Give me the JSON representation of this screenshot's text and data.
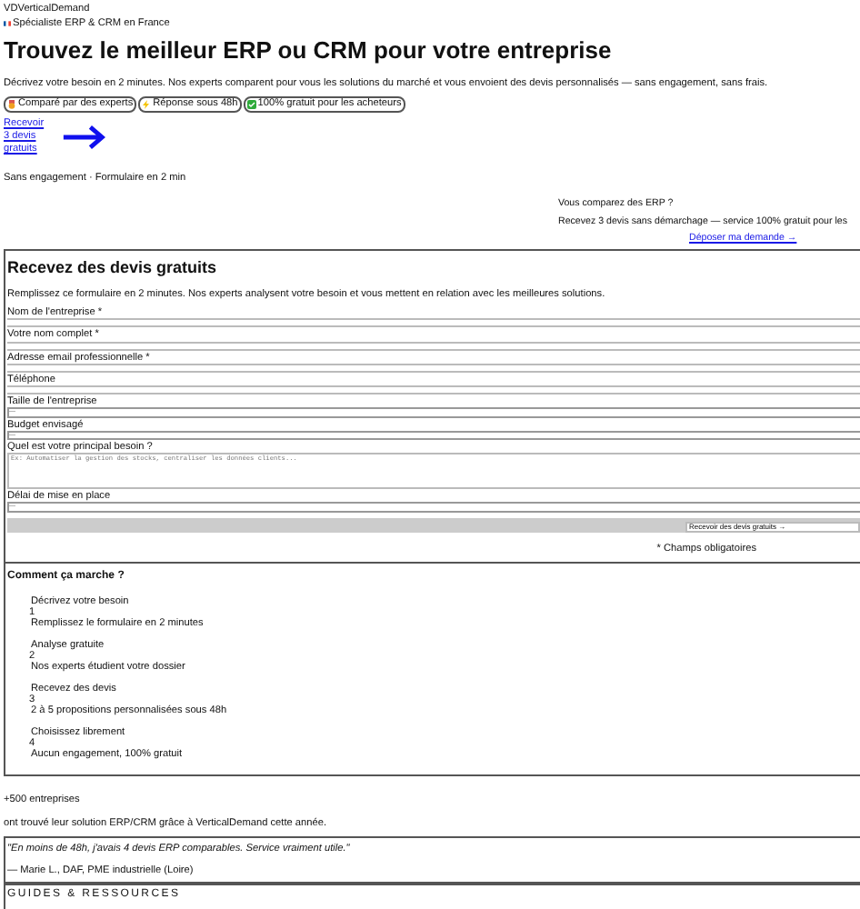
{
  "header": {
    "brand": "VDVerticalDemand",
    "tagline": "Spécialiste ERP & CRM en France"
  },
  "hero": {
    "title": "Trouvez le meilleur ERP ou CRM pour votre entreprise",
    "description": "Décrivez votre besoin en 2 minutes. Nos experts comparent pour vous les solutions du marché et vous envoient des devis personnalisés — sans engagement, sans frais.",
    "badges": [
      {
        "kind": "medal",
        "label": "Comparé par des experts"
      },
      {
        "kind": "bolt",
        "label": "Réponse sous 48h"
      },
      {
        "kind": "check",
        "label": "100% gratuit pour les acheteurs"
      }
    ],
    "cta_link": "Recevoir 3 devis gratuits",
    "note": "Sans engagement · Formulaire en 2 min"
  },
  "promo": {
    "title": "Vous comparez des ERP ?",
    "text": "Recevez 3 devis sans démarchage — service 100% gratuit pour les",
    "link": "Déposer ma demande →"
  },
  "form": {
    "title": "Recevez des devis gratuits",
    "description": "Remplissez ce formulaire en 2 minutes. Nos experts analysent votre besoin et vous mettent en relation avec les meilleures solutions.",
    "fields": [
      {
        "kind": "text",
        "label": "Nom de l'entreprise *"
      },
      {
        "kind": "text",
        "label": "Votre nom complet *"
      },
      {
        "kind": "text",
        "label": "Adresse email professionnelle *"
      },
      {
        "kind": "text",
        "label": "Téléphone"
      },
      {
        "kind": "select",
        "label": "Taille de l'entreprise",
        "value": "—"
      },
      {
        "kind": "select",
        "label": "Budget envisagé",
        "value": "—"
      },
      {
        "kind": "textarea",
        "label": "Quel est votre principal besoin ?",
        "placeholder": "Ex: Automatiser la gestion des stocks, centraliser les données clients..."
      },
      {
        "kind": "select",
        "label": "Délai de mise en place",
        "value": "—"
      }
    ],
    "submit": "Recevoir des devis gratuits →",
    "required_note": "* Champs obligatoires"
  },
  "steps": {
    "title": "Comment ça marche ?",
    "items": [
      {
        "title": "Décrivez votre besoin",
        "number": "1",
        "text": "Remplissez le formulaire en 2 minutes"
      },
      {
        "title": "Analyse gratuite",
        "number": "2",
        "text": "Nos experts étudient votre dossier"
      },
      {
        "title": "Recevez des devis",
        "number": "3",
        "text": "2 à 5 propositions personnalisées sous 48h"
      },
      {
        "title": "Choisissez librement",
        "number": "4",
        "text": "Aucun engagement, 100% gratuit"
      }
    ]
  },
  "stats": {
    "count": "+500 entreprises",
    "text": "ont trouvé leur solution ERP/CRM grâce à VerticalDemand cette année."
  },
  "testimonial": {
    "quote": "\"En moins de 48h, j'avais 4 devis ERP comparables. Service vraiment utile.\"",
    "author": "— Marie L., DAF, PME industrielle (Loire)"
  },
  "guides": {
    "title": "GUIDES & RESSOURCES"
  }
}
